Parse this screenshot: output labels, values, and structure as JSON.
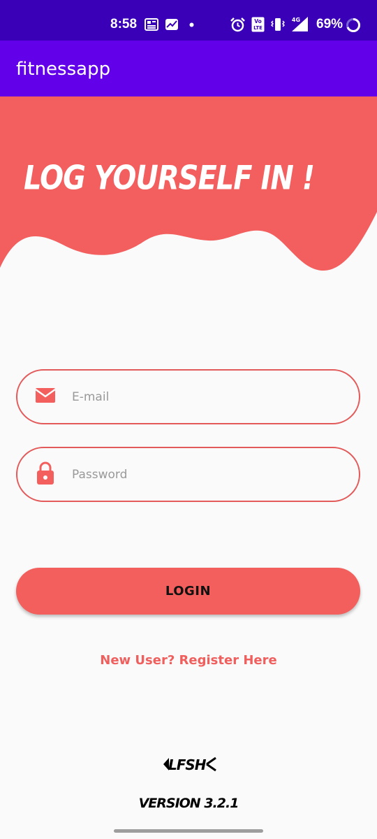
{
  "status_bar": {
    "time": "8:58",
    "battery_percent": "69%",
    "network": "4G",
    "volte": "VoLTE",
    "icons": [
      "news-icon",
      "chart-icon",
      "notification-dot-icon",
      "alarm-icon",
      "volte-icon",
      "vibrate-icon",
      "signal-icon",
      "battery-ring-icon"
    ]
  },
  "app_bar": {
    "title": "fitnessapp"
  },
  "header": {
    "headline": "LOG YOURSELF IN !"
  },
  "form": {
    "email": {
      "placeholder": "E-mail",
      "value": "",
      "icon": "email-icon"
    },
    "password": {
      "placeholder": "Password",
      "value": "",
      "icon": "lock-icon"
    },
    "login_label": "LOGIN",
    "register_label": "New User? Register Here"
  },
  "footer": {
    "logo_text": "LFSH",
    "version": "VERSION 3.2.1"
  },
  "colors": {
    "status_bar": "#3a00b8",
    "app_bar": "#6200ea",
    "accent": "#f25f5c",
    "background": "#fafafa"
  }
}
